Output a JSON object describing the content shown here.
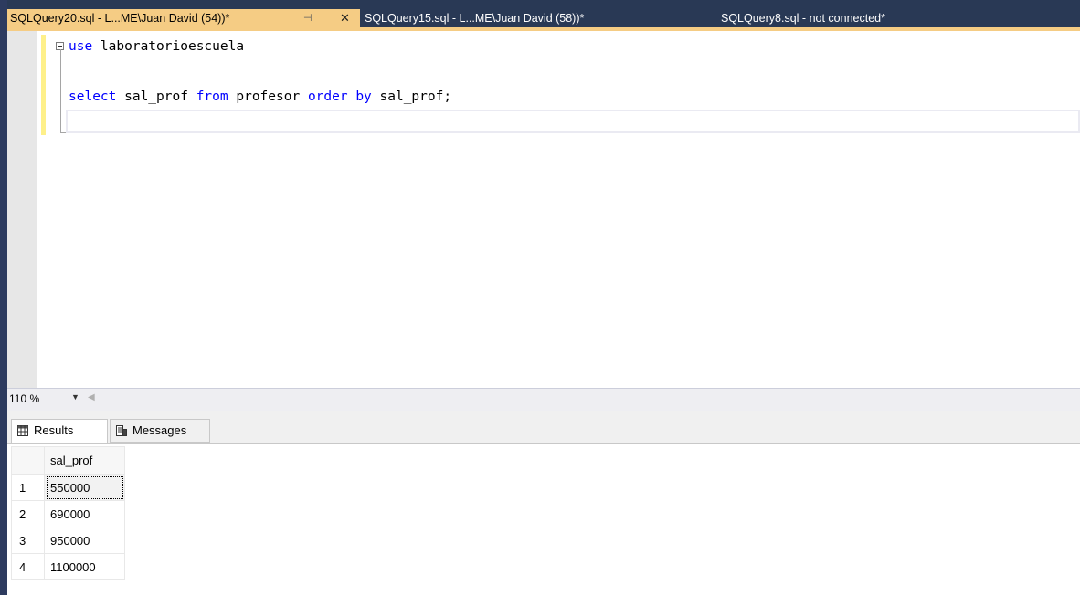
{
  "tabs": [
    {
      "title": "SQLQuery20.sql - L...ME\\Juan David (54))*",
      "active": true
    },
    {
      "title": "SQLQuery15.sql - L...ME\\Juan David (58))*",
      "active": false
    },
    {
      "title": "SQLQuery8.sql - not connected*",
      "active": false
    }
  ],
  "tab_icons": {
    "pin": "pin-icon",
    "close": "close-icon"
  },
  "editor": {
    "line1_kw": "use",
    "line1_rest": " laboratorioescuela",
    "line2": {
      "kw1": "select",
      "t1": " sal_prof ",
      "kw2": "from",
      "t2": " profesor ",
      "kw3": "order by",
      "t3": " sal_prof;"
    }
  },
  "zoom": {
    "level": "110 %"
  },
  "results_tabs": {
    "results": "Results",
    "messages": "Messages"
  },
  "grid": {
    "column": "sal_prof",
    "rows": [
      {
        "n": "1",
        "v": "550000"
      },
      {
        "n": "2",
        "v": "690000"
      },
      {
        "n": "3",
        "v": "950000"
      },
      {
        "n": "4",
        "v": "1100000"
      }
    ]
  },
  "colors": {
    "active_tab": "#f5cc84",
    "tabstrip": "#293955",
    "keyword": "#0000ff"
  }
}
